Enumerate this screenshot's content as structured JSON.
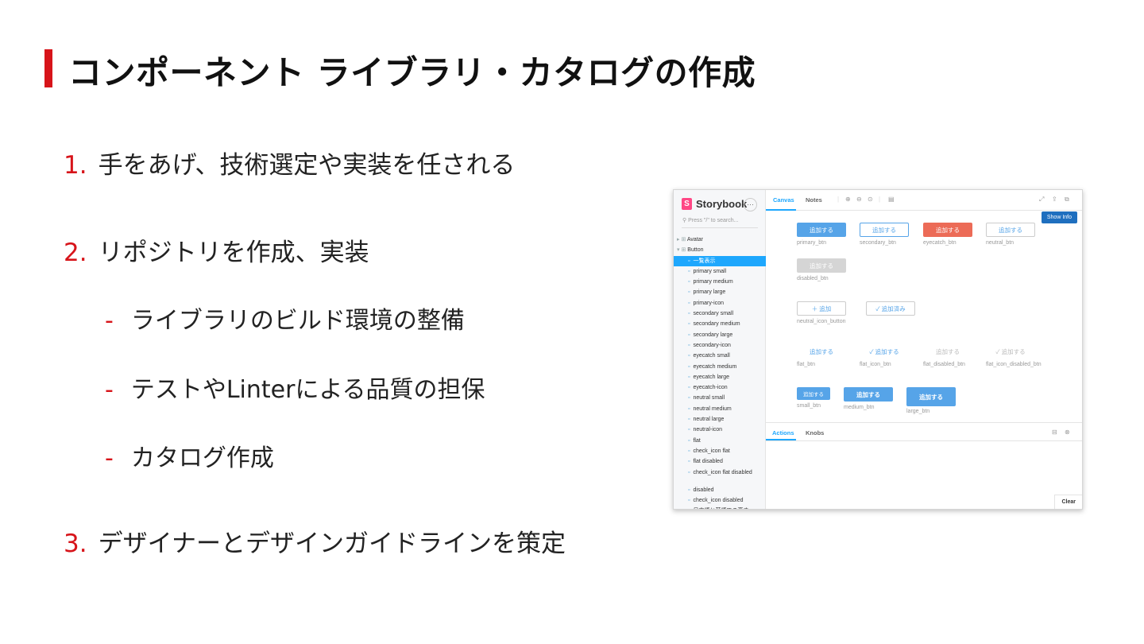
{
  "slide": {
    "title": "コンポーネント ライブラリ・カタログの作成",
    "items": [
      {
        "num": "1.",
        "text": "手をあげ、技術選定や実装を任される"
      },
      {
        "num": "2.",
        "text": "リポジトリを作成、実装"
      },
      {
        "num": "3.",
        "text": "デザイナーとデザインガイドラインを策定"
      }
    ],
    "subitems": [
      {
        "dash": "-",
        "text": "ライブラリのビルド環境の整備"
      },
      {
        "dash": "-",
        "text": "テストやLinterによる品質の担保"
      },
      {
        "dash": "-",
        "text": "カタログ作成"
      }
    ]
  },
  "storybook": {
    "brand": "Storybook",
    "menu_icon": "ellipsis-icon",
    "search_placeholder": "Press \"/\" to search...",
    "tree": [
      {
        "label": "Avatar",
        "kind": "group"
      },
      {
        "label": "Button",
        "kind": "group"
      },
      {
        "label": "一覧表示",
        "kind": "leaf",
        "selected": true
      },
      {
        "label": "primary small",
        "kind": "leaf"
      },
      {
        "label": "primary medium",
        "kind": "leaf"
      },
      {
        "label": "primary large",
        "kind": "leaf"
      },
      {
        "label": "primary-icon",
        "kind": "leaf"
      },
      {
        "label": "secondary small",
        "kind": "leaf"
      },
      {
        "label": "secondary medium",
        "kind": "leaf"
      },
      {
        "label": "secondary large",
        "kind": "leaf"
      },
      {
        "label": "secondary-icon",
        "kind": "leaf"
      },
      {
        "label": "eyecatch small",
        "kind": "leaf"
      },
      {
        "label": "eyecatch medium",
        "kind": "leaf"
      },
      {
        "label": "eyecatch large",
        "kind": "leaf"
      },
      {
        "label": "eyecatch-icon",
        "kind": "leaf"
      },
      {
        "label": "neutral small",
        "kind": "leaf"
      },
      {
        "label": "neutral medium",
        "kind": "leaf"
      },
      {
        "label": "neutral large",
        "kind": "leaf"
      },
      {
        "label": "neutral-icon",
        "kind": "leaf"
      },
      {
        "label": "flat",
        "kind": "leaf"
      },
      {
        "label": "check_icon flat",
        "kind": "leaf"
      },
      {
        "label": "flat disabled",
        "kind": "leaf"
      },
      {
        "label": "check_icon flat disabled",
        "kind": "leaf",
        "twoline": true
      },
      {
        "label": "disabled",
        "kind": "leaf"
      },
      {
        "label": "check_icon disabled",
        "kind": "leaf"
      },
      {
        "label": "日本語と英語での高さ",
        "kind": "leaf"
      }
    ],
    "tabs": {
      "canvas": "Canvas",
      "notes": "Notes"
    },
    "show_info": "Show Info",
    "buttons": {
      "add": "追加する",
      "add_short": "＋ 追加",
      "added": "✓ 追加済み",
      "check_add": "✓ 追加する"
    },
    "captions": {
      "primary": "primary_btn",
      "secondary": "secondary_btn",
      "eyecatch": "eyecatch_btn",
      "neutral": "neutral_btn",
      "disabled": "disabled_btn",
      "neutral_icon": "neutral_icon_button",
      "flat": "flat_btn",
      "flat_icon": "flat_icon_btn",
      "flat_disabled": "flat_disabled_btn",
      "flat_icon_disabled": "flat_icon_disabled_btn",
      "small": "small_btn",
      "medium": "medium_btn",
      "large": "large_btn"
    },
    "panel": {
      "actions": "Actions",
      "knobs": "Knobs",
      "clear": "Clear"
    },
    "colors": {
      "accent": "#1ea7fd",
      "primary": "#56a4e8",
      "eyecatch": "#ec6b57",
      "brand": "#ff4785",
      "red": "#d7141a"
    }
  }
}
